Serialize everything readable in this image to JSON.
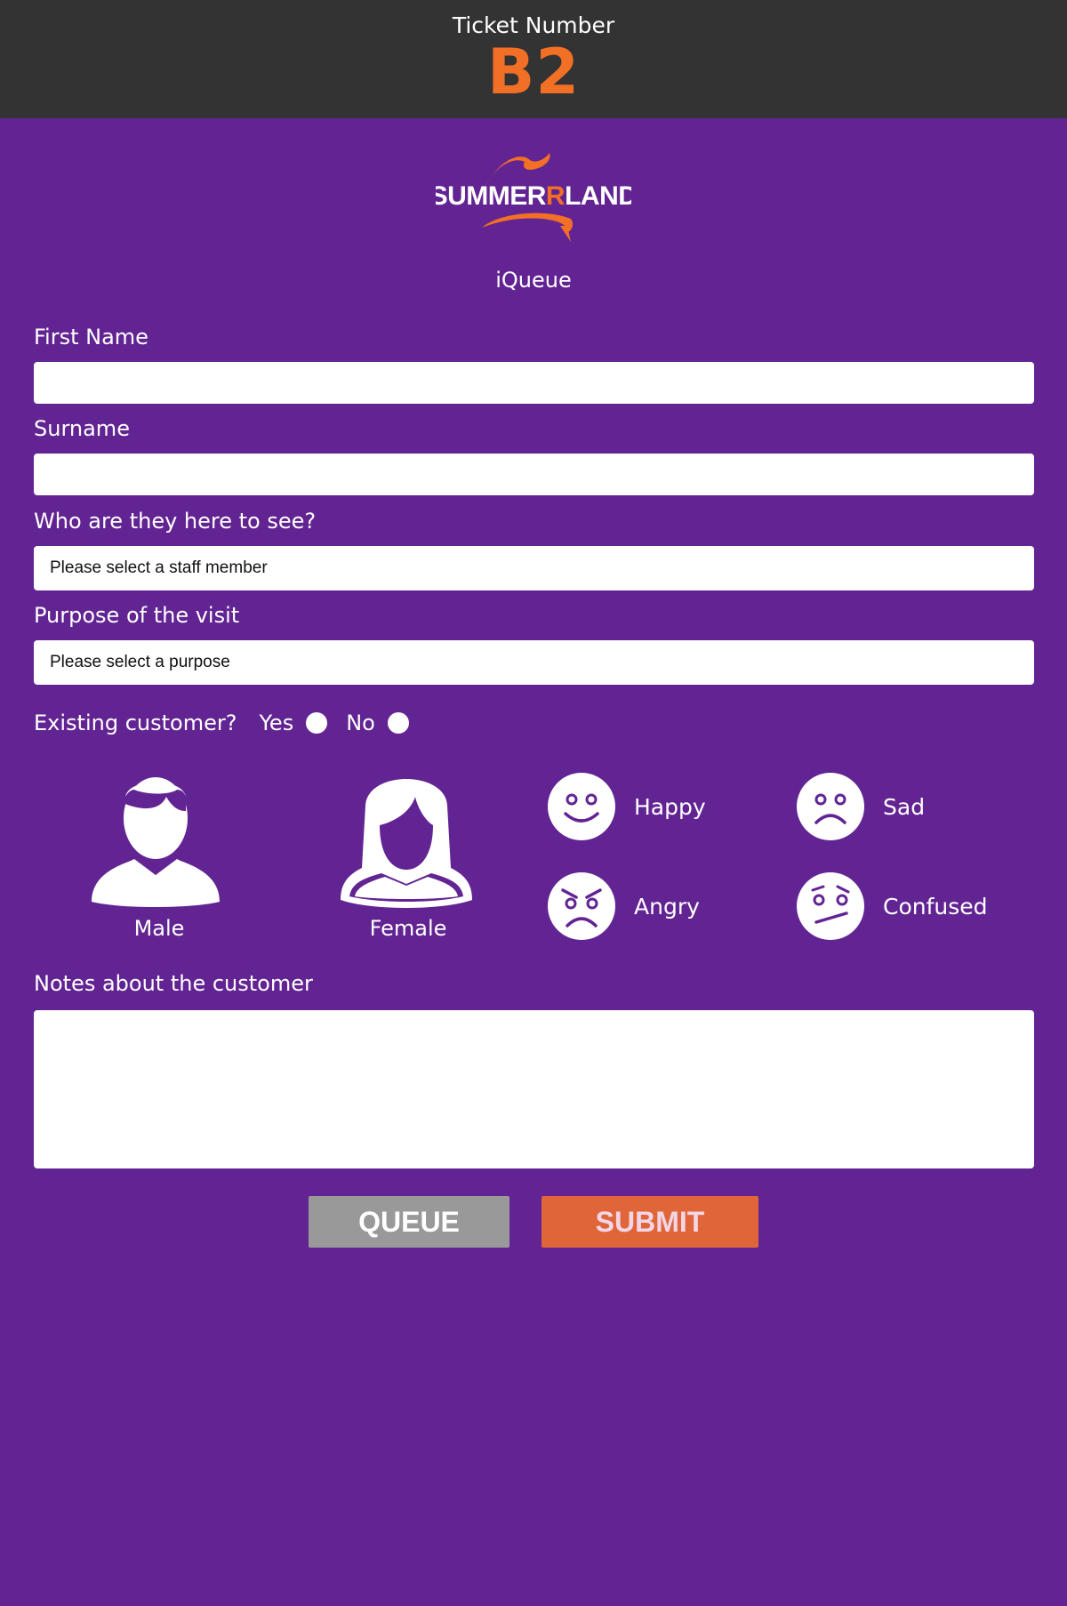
{
  "header": {
    "ticket_label": "Ticket Number",
    "ticket_number": "B2",
    "ticket_color": "#f26f26",
    "bar_color": "#333333"
  },
  "brand": {
    "logo_text_left": "SUMMER",
    "logo_text_accent": "R",
    "logo_text_right": "LAND",
    "app_name": "iQueue",
    "background_color": "#632493",
    "accent_color": "#f26f26"
  },
  "form": {
    "first_name": {
      "label": "First Name",
      "value": ""
    },
    "surname": {
      "label": "Surname",
      "value": ""
    },
    "staff": {
      "label": "Who are they here to see?",
      "selected": "Please select a staff member"
    },
    "purpose": {
      "label": "Purpose of the visit",
      "selected": "Please select a purpose"
    },
    "existing_customer": {
      "label": "Existing customer?",
      "options": [
        {
          "label": "Yes",
          "checked": false
        },
        {
          "label": "No",
          "checked": false
        }
      ]
    },
    "gender": [
      {
        "label": "Male",
        "icon": "male-avatar-icon"
      },
      {
        "label": "Female",
        "icon": "female-avatar-icon"
      }
    ],
    "moods": [
      {
        "label": "Happy",
        "icon": "happy-face-icon"
      },
      {
        "label": "Sad",
        "icon": "sad-face-icon"
      },
      {
        "label": "Angry",
        "icon": "angry-face-icon"
      },
      {
        "label": "Confused",
        "icon": "confused-face-icon"
      }
    ],
    "notes": {
      "label": "Notes about the customer",
      "value": ""
    }
  },
  "actions": {
    "queue_label": "QUEUE",
    "submit_label": "SUBMIT",
    "queue_color": "#999999",
    "submit_color": "#e0663a"
  }
}
